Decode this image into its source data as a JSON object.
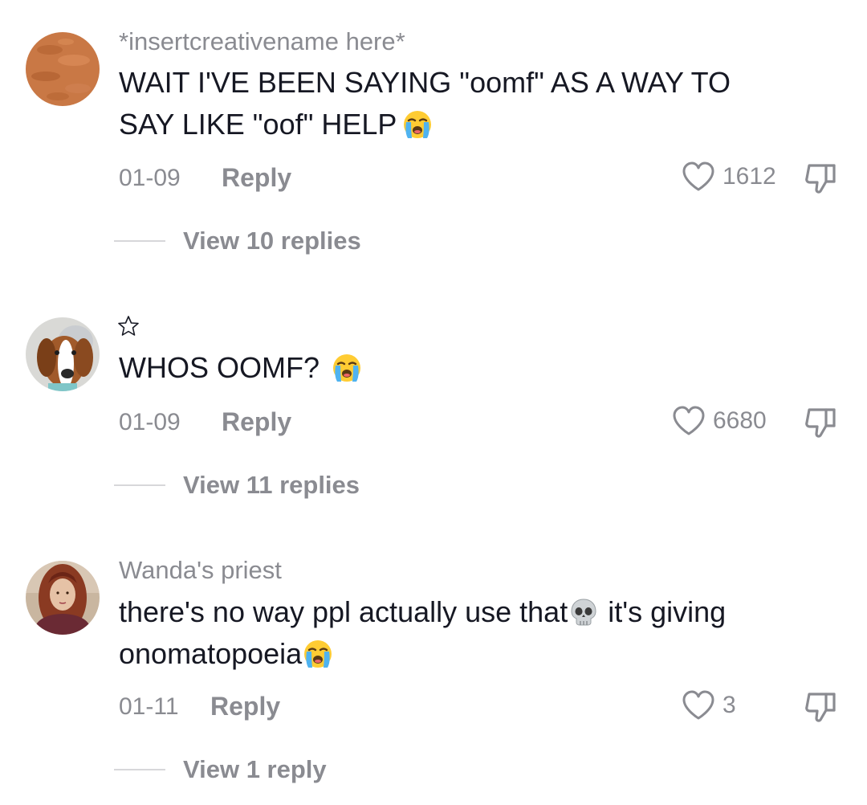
{
  "comments": [
    {
      "username": "*insertcreativename here*",
      "text_lines": [
        "WAIT I'VE BEEN SAYING \"oomf\" AS A WAY TO",
        "SAY LIKE \"oof\" HELP"
      ],
      "date": "01-09",
      "reply_label": "Reply",
      "likes": "1612",
      "view_replies": "View 10 replies",
      "emoji": "loudly-crying-face-emoji"
    },
    {
      "username_icon": "star-outline-icon",
      "text": "WHOS OOMF?",
      "date": "01-09",
      "reply_label": "Reply",
      "likes": "6680",
      "view_replies": "View 11 replies",
      "emoji": "loudly-crying-face-emoji"
    },
    {
      "username": "Wanda's priest",
      "text_line1": "there's no way ppl actually use that",
      "text_line1_tail": "it's giving",
      "text_line2": "onomatopoeia",
      "date": "01-11",
      "reply_label": "Reply",
      "likes": "3",
      "view_replies": "View 1 reply",
      "emojis": [
        "skull-emoji",
        "loudly-crying-face-emoji"
      ]
    }
  ],
  "colors": {
    "primary_text": "#161823",
    "secondary_text": "#8a8b91",
    "divider": "#d7d7da"
  }
}
